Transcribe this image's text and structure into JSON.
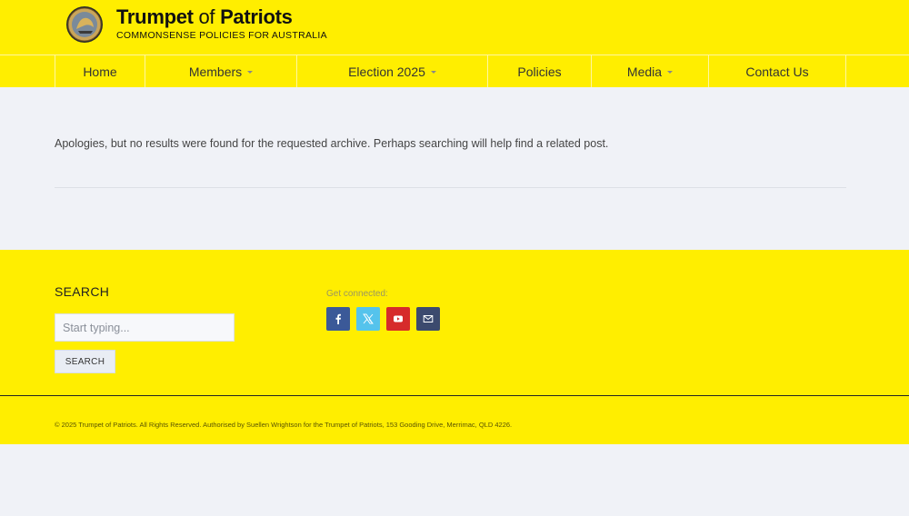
{
  "header": {
    "brand_name_part1": "Trumpet",
    "brand_name_part2": "of",
    "brand_name_part3": "Patriots",
    "tagline": "COMMONSENSE POLICIES FOR AUSTRALIA",
    "logo_icon": "trumpet-of-patriots-seal"
  },
  "nav": {
    "items": [
      {
        "label": "Home",
        "has_dropdown": false
      },
      {
        "label": "Members",
        "has_dropdown": true
      },
      {
        "label": "Election 2025",
        "has_dropdown": true
      },
      {
        "label": "Policies",
        "has_dropdown": false
      },
      {
        "label": "Media",
        "has_dropdown": true
      },
      {
        "label": "Contact Us",
        "has_dropdown": false
      }
    ]
  },
  "main": {
    "message": "Apologies, but no results were found for the requested archive. Perhaps searching will help find a related post."
  },
  "footer": {
    "search": {
      "title": "SEARCH",
      "placeholder": "Start typing...",
      "value": "",
      "button_label": "SEARCH"
    },
    "social": {
      "label": "Get connected:",
      "links": [
        {
          "name": "facebook",
          "icon": "facebook-icon",
          "color": "#3b5998"
        },
        {
          "name": "x",
          "icon": "x-twitter-icon",
          "color": "#55c3ec"
        },
        {
          "name": "youtube",
          "icon": "youtube-icon",
          "color": "#d62b2b"
        },
        {
          "name": "email",
          "icon": "envelope-icon",
          "color": "#3c4a6e"
        }
      ]
    },
    "copyright": "© 2025 Trumpet of Patriots. All Rights Reserved. Authorised by Suellen Wrightson for the Trumpet of Patriots, 153 Gooding Drive, Merrimac, QLD 4226."
  },
  "colors": {
    "brand_yellow": "#ffee00",
    "page_background": "#f0f2f7"
  }
}
